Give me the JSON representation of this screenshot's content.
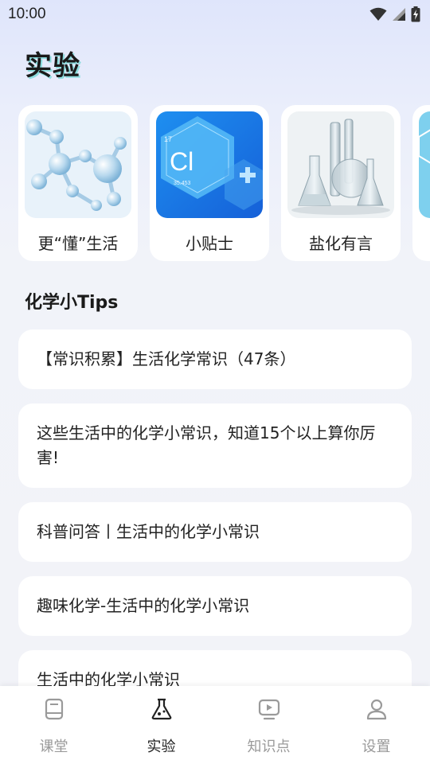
{
  "status": {
    "time": "10:00"
  },
  "page": {
    "title": "实验"
  },
  "cards": [
    {
      "label": "更“懂”生活"
    },
    {
      "label": "小贴士",
      "element_symbol": "Cl",
      "atomic_number": "17",
      "atomic_mass": "35.453"
    },
    {
      "label": "盐化有言"
    },
    {
      "label": ""
    }
  ],
  "section": {
    "title": "化学小Tips"
  },
  "tips": [
    "【常识积累】生活化学常识（47条）",
    "这些生活中的化学小常识，知道15个以上算你厉害!",
    "科普问答丨生活中的化学小常识",
    "趣味化学-生活中的化学小常识",
    "生活中的化学小常识"
  ],
  "tabs": [
    {
      "label": "课堂",
      "icon": "book-icon",
      "active": false
    },
    {
      "label": "实验",
      "icon": "flask-icon",
      "active": true
    },
    {
      "label": "知识点",
      "icon": "video-icon",
      "active": false
    },
    {
      "label": "设置",
      "icon": "person-icon",
      "active": false
    }
  ],
  "colors": {
    "accent_shadow": "#46d2c8",
    "active_tab": "#222222",
    "inactive_tab": "#9a9a9a"
  }
}
